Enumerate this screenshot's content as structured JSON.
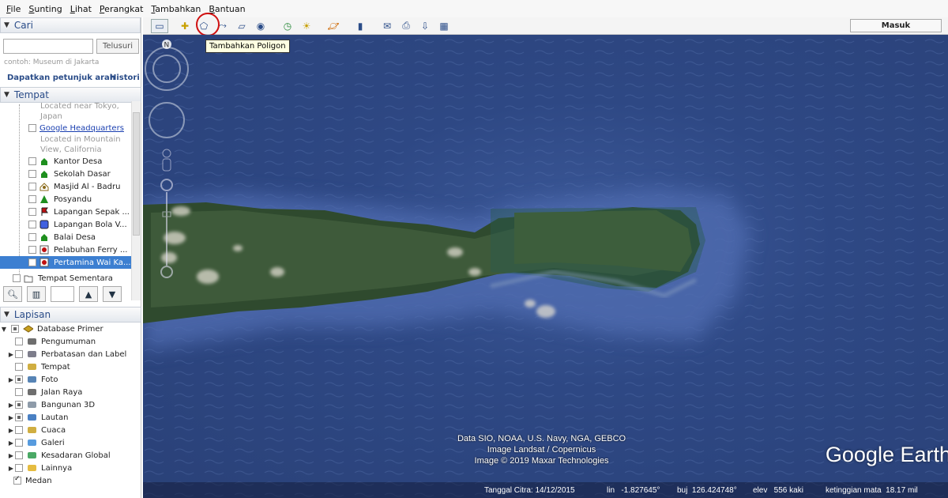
{
  "menu": [
    "File",
    "Sunting",
    "Lihat",
    "Perangkat",
    "Tambahkan",
    "Bantuan"
  ],
  "search": {
    "title": "Cari",
    "placeholder": "",
    "button": "Telusuri",
    "hint": "contoh: Museum di Jakarta",
    "directions": "Dapatkan petunjuk arah",
    "history": "Histori"
  },
  "places": {
    "title": "Tempat",
    "top_sub": [
      "Located near Tokyo,",
      "Japan"
    ],
    "google_hq": "Google Headquarters",
    "google_hq_sub": [
      "Located in Mountain",
      "View, California"
    ],
    "items": [
      {
        "label": "Kantor Desa",
        "icon": "house-pin-icon",
        "color": "#1e8f1e"
      },
      {
        "label": "Sekolah Dasar",
        "icon": "house-pin-icon",
        "color": "#1e8f1e"
      },
      {
        "label": "Masjid Al - Badru",
        "icon": "mosque-icon",
        "color": "#8a6a1a"
      },
      {
        "label": "Posyandu",
        "icon": "triangle-pin-icon",
        "color": "#1e8f1e"
      },
      {
        "label": "Lapangan Sepak ...",
        "icon": "flag-icon",
        "color": "#c01010"
      },
      {
        "label": "Lapangan Bola V...",
        "icon": "square-pin-icon",
        "color": "#4060e0"
      },
      {
        "label": "Balai Desa",
        "icon": "house-pin-icon",
        "color": "#1e8f1e"
      },
      {
        "label": "Pelabuhan Ferry ...",
        "icon": "dot-pin-icon",
        "color": "#c01010"
      },
      {
        "label": "Pertamina Wai Ka...",
        "icon": "dot-pin-icon",
        "color": "#c01010"
      }
    ],
    "temp": "Tempat Sementara"
  },
  "layers": {
    "title": "Lapisan",
    "root": "Database Primer",
    "items": [
      {
        "label": "Pengumuman",
        "icon": "envelope-icon",
        "arrow": false,
        "state": "empty"
      },
      {
        "label": "Perbatasan dan Label",
        "icon": "label-flag-icon",
        "arrow": true,
        "state": "empty"
      },
      {
        "label": "Tempat",
        "icon": "place-icon",
        "arrow": false,
        "state": "empty"
      },
      {
        "label": "Foto",
        "icon": "photo-icon",
        "arrow": true,
        "state": "part"
      },
      {
        "label": "Jalan Raya",
        "icon": "road-icon",
        "arrow": false,
        "state": "empty"
      },
      {
        "label": "Bangunan 3D",
        "icon": "building-icon",
        "arrow": true,
        "state": "part"
      },
      {
        "label": "Lautan",
        "icon": "ocean-icon",
        "arrow": true,
        "state": "part"
      },
      {
        "label": "Cuaca",
        "icon": "weather-icon",
        "arrow": true,
        "state": "empty"
      },
      {
        "label": "Galeri",
        "icon": "gallery-icon",
        "arrow": true,
        "state": "empty"
      },
      {
        "label": "Kesadaran Global",
        "icon": "globe-icon",
        "arrow": true,
        "state": "empty"
      },
      {
        "label": "Lainnya",
        "icon": "more-icon",
        "arrow": true,
        "state": "empty"
      },
      {
        "label": "Medan",
        "icon": "",
        "arrow": false,
        "state": "chk"
      }
    ]
  },
  "toolbar": {
    "signin": "Masuk",
    "tooltip": "Tambahkan Poligon"
  },
  "map": {
    "attribution": [
      "Data SIO, NOAA, U.S. Navy, NGA, GEBCO",
      "Image Landsat / Copernicus",
      "Image © 2019 Maxar Technologies"
    ],
    "logo": "Google Earth",
    "status": {
      "date": "Tanggal Citra: 14/12/2015",
      "lat": "lin   -1.827645°",
      "lon": "buj  126.424748°",
      "elev": "elev   556 kaki",
      "eye": "ketinggian mata  18.17 mil"
    }
  },
  "colors": {
    "accent": "#2a4c88",
    "selection": "#3c7fd1",
    "ocean": "#2e4884",
    "highlight": "#d01010"
  }
}
